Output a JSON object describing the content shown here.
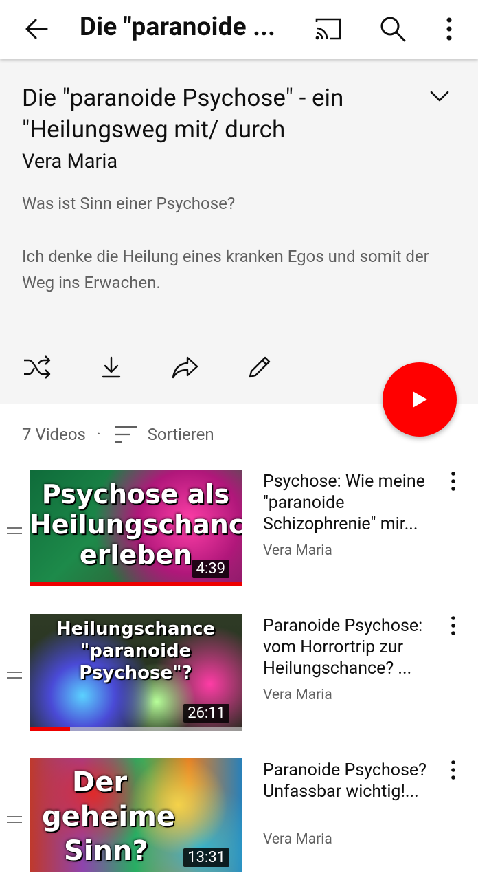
{
  "appbar": {
    "title": "Die \"paranoide ...",
    "back_icon": "arrow-left-icon",
    "cast_icon": "cast-icon",
    "search_icon": "search-icon",
    "more_icon": "more-vert-icon"
  },
  "playlist": {
    "title": "Die \"paranoide Psychose\" - ein \"Heilungsweg mit/ durch",
    "owner": "Vera Maria",
    "description_line1": "Was ist Sinn einer Psychose?",
    "description_line2": "Ich denke die Heilung eines kranken Egos und somit der Weg ins Erwachen.",
    "actions": [
      "shuffle-icon",
      "download-icon",
      "share-icon",
      "edit-icon"
    ],
    "play_all_icon": "play-icon"
  },
  "list": {
    "count": "7 Videos",
    "separator": "·",
    "sort_label": "Sortieren"
  },
  "videos": [
    {
      "title": "Psychose: Wie meine \"paranoide Schizophrenie\" mir...",
      "channel": "Vera Maria",
      "duration": "4:39",
      "thumb_lines": [
        "Psychose als",
        "Heilungschance",
        "erleben"
      ],
      "watched_percent": 100
    },
    {
      "title": "Paranoide Psychose: vom Horrortrip zur Heilungschance? ...",
      "channel": "Vera Maria",
      "duration": "26:11",
      "thumb_lines": [
        "Heilungschance",
        "\"paranoide Psychose\"?"
      ],
      "watched_percent": 19
    },
    {
      "title": "Paranoide Psychose? Unfassbar wichtig!...",
      "channel": "Vera Maria",
      "duration": "13:31",
      "thumb_lines": [
        "Der",
        "geheime",
        "Sinn?"
      ],
      "watched_percent": 0
    }
  ],
  "colors": {
    "accent": "#ff0000",
    "header_bg": "#f5f5f5",
    "secondary_text": "#606060"
  }
}
